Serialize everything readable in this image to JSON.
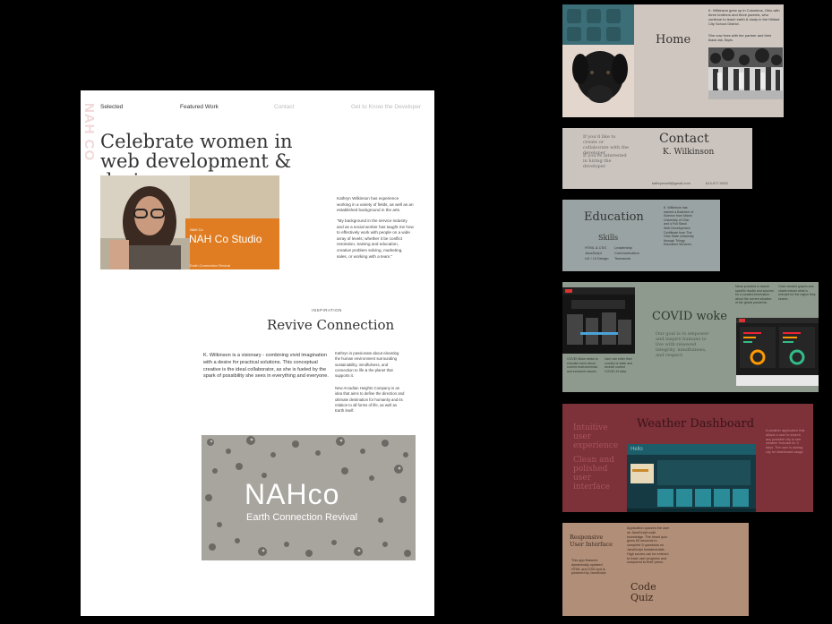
{
  "main": {
    "logo_vertical": "NAH CO",
    "nav": [
      "Selected",
      "Featured Work",
      "Contact",
      "Get to Know the Developer"
    ],
    "hero_title": "Celebrate women in web development & design",
    "photo_caption_small": "NAH Co",
    "photo_caption": "NAH Co Studio",
    "photo_caption_sub": "Earth Connection Revival",
    "about_p1": "Kathryn Wilkinson has experience working in a variety of fields, as well as an established background in the arts.",
    "about_p2": "\"My background in the service industry and as a social worker has taught me how to effectively work with people on a wide array of levels; whether it be conflict resolution, training and education, creative problem solving, marketing, sales, or working with a team.\"",
    "eyebrow": "INSPIRATION",
    "section_title": "Revive Connection",
    "vision_text": "K. Wilkinson is a visionary - combining vivid imagination with a desire for practical solutions. This conceptual creative is the ideal collaborator, as she is fueled by the spark of possibility she sees in everything and everyone.",
    "revive_p1": "Kathryn is passionate about elevating the human environment surrounding sustainability, mindfulness, and connection to life & the planet that supports it.",
    "revive_p2": "New Arcadian Heights Company is an idea that aims to define the direction and ultimate destination for humanity and its relation to all forms of life, as well as Earth itself.",
    "drops_logo": "NAHco",
    "drops_sub": "Earth Connection Revival"
  },
  "home_card": {
    "title": "Home",
    "text1": "K. Wilkinson grew up in Columbus, Ohio with three brothers and three parents, who continue to teach earth & study in the Hilliard City School District.",
    "text2": "She now lives with her partner and their black lab, Bipin."
  },
  "contact_card": {
    "title": "Contact",
    "name": "K. Wilkinson",
    "text1": "If you'd like to create or collaborate with the developer",
    "text2": "If you're interested in hiring the developer",
    "email": "kathryncwill@gmail.com",
    "phone": "614-677-0902"
  },
  "education_card": {
    "title": "Education",
    "skills_title": "Skills",
    "skills_col1": [
      "HTML & CSS",
      "JavaScript",
      "UX / UI Design"
    ],
    "skills_col2": [
      "Leadership",
      "Communication",
      "Teamwork"
    ],
    "text": "K. Wilkinson has earned a Bachelor of Science from Miami University of Ohio and a Full Stack Web Development Certificate from The Ohio State University through Trilogy Education Services."
  },
  "covid_card": {
    "title": "COVID woke",
    "subtitle": "Our goal is to empower and inspire humans to live with renewed integrity, mindfulness, and respect.",
    "left_text": "COVID Woke seeks to educate users about current environmental and economic issues.",
    "left_text2": "User can enter their country or state and receive current COVID-19 data.",
    "right_text": "News provided in search specific results and sources for a curated information about the current situation of the global pandemic.",
    "right_text2": "Once needed graphs and charts extract what is relevant for the region they search."
  },
  "weather_card": {
    "title": "Weather Dashboard",
    "left_text1": "Intuitive user experience",
    "left_text2": "Clean and polished user interface",
    "right_text": "A weather application that allows a user to search any possible city to see weather forecast for 5 days. The user is storing city for dashboard usage.",
    "screen_title": "Hello"
  },
  "quiz_card": {
    "title1": "Responsive User Interface",
    "text1": "This app features dynamically updated HTML and CSS and is powered by JavaScript.",
    "text2": "Application quizzes the user on JavaScript code knowledge. The timed quiz gives 60 seconds to complete 5 questions on JavaScript fundamentals. High scores can be entered to track user progress and compared to their peers.",
    "title2": "Code Quiz"
  },
  "colors": {
    "background": "#000000",
    "hero_text": "#333333",
    "logo_pink": "#f2d7d9",
    "home_card": "#cfc6bf",
    "contact_card": "#cbc3bd",
    "education_card": "#9aa3a3",
    "covid_card": "#8f9a8e",
    "weather_card": "#7d3139",
    "quiz_card": "#b08e78",
    "studio_orange": "#e07d22"
  }
}
